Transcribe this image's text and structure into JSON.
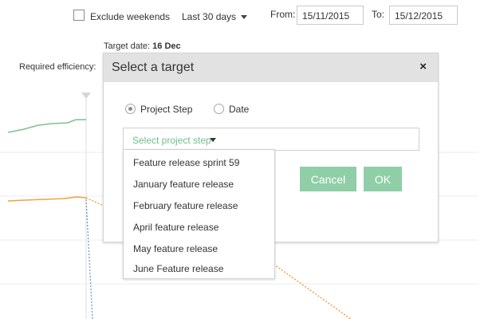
{
  "toolbar": {
    "exclude_weekends_label": "Exclude weekends",
    "exclude_weekends_checked": false,
    "range_selected": "Last 30 days",
    "from_label": "From:",
    "from_value": "15/11/2015",
    "to_label": "To:",
    "to_value": "15/12/2015"
  },
  "chart_info": {
    "target_date_label": "Target date:",
    "target_date_value": "16 Dec",
    "required_efficiency_label": "Required efficiency:"
  },
  "modal": {
    "title": "Select a target",
    "close_glyph": "×",
    "radio_options": [
      {
        "label": "Project Step",
        "checked": true
      },
      {
        "label": "Date",
        "checked": false
      }
    ],
    "select_placeholder": "Select project step",
    "cancel_label": "Cancel",
    "ok_label": "OK"
  },
  "dropdown": {
    "items": [
      "Feature release sprint 59",
      "January feature release",
      "February feature release",
      "April feature release",
      "May feature release",
      "June Feature release"
    ]
  },
  "colors": {
    "green_line": "#7cc28c",
    "orange_line": "#f4a142",
    "blue_dotted": "#6b98d0",
    "accent_button": "#8fcea7",
    "select_text": "#6fbf8a",
    "modal_header": "#e2e2e2"
  }
}
